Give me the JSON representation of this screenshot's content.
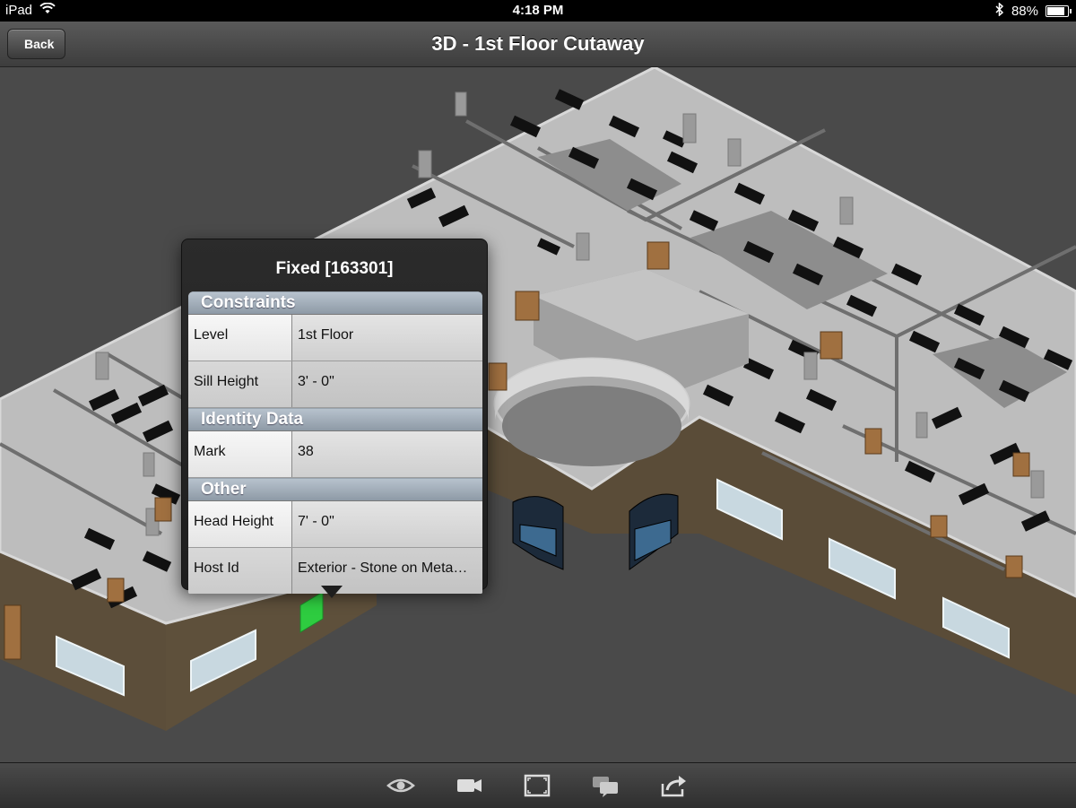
{
  "status_bar": {
    "device": "iPad",
    "time": "4:18 PM",
    "battery": "88%",
    "battery_level": 0.88
  },
  "nav": {
    "title": "3D - 1st Floor Cutaway",
    "back_label": "Back"
  },
  "popover": {
    "title": "Fixed [163301]",
    "sections": [
      {
        "header": "Constraints",
        "rows": [
          {
            "label": "Level",
            "value": "1st Floor"
          },
          {
            "label": "Sill Height",
            "value": "3' - 0\""
          }
        ]
      },
      {
        "header": "Identity Data",
        "rows": [
          {
            "label": "Mark",
            "value": "38"
          }
        ]
      },
      {
        "header": "Other",
        "rows": [
          {
            "label": "Head Height",
            "value": "7' - 0\""
          },
          {
            "label": "Host Id",
            "value": "Exterior - Stone on Meta…"
          }
        ]
      }
    ]
  },
  "toolbar": {
    "buttons": [
      "eye-icon",
      "camera-icon",
      "fit-view-icon",
      "comments-icon",
      "share-icon"
    ]
  },
  "colors": {
    "background": "#4a4a4a",
    "exterior_wall": "#5c4e3a",
    "floor": "#bdbdbd",
    "highlight": "#2ecc40",
    "door": "#a07040"
  }
}
